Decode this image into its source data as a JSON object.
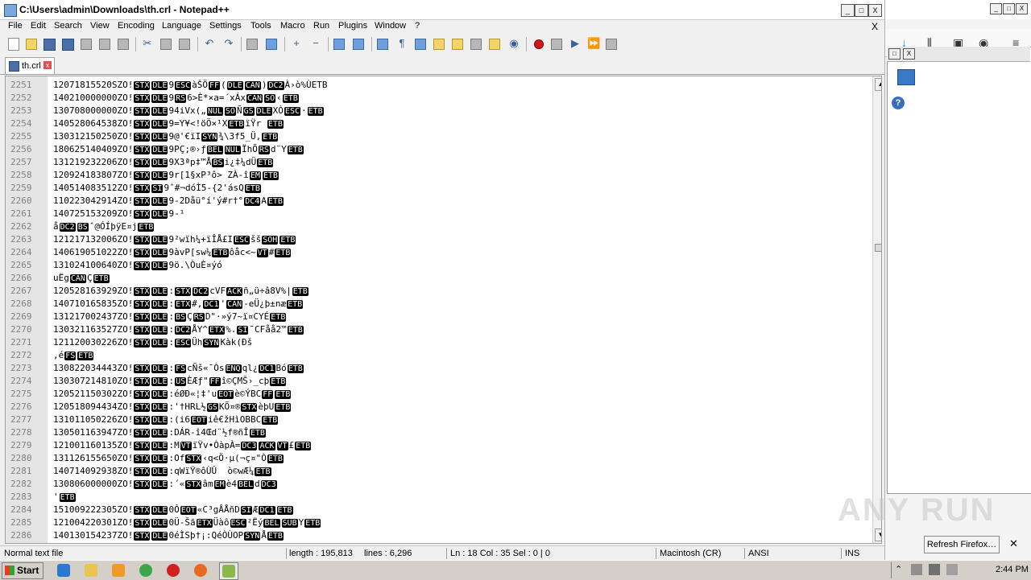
{
  "window": {
    "title": "C:\\Users\\admin\\Downloads\\th.crl - Notepad++",
    "controls": [
      "_",
      "□",
      "X"
    ]
  },
  "menu": [
    "File",
    "Edit",
    "Search",
    "View",
    "Encoding",
    "Language",
    "Settings",
    "Tools",
    "Macro",
    "Run",
    "Plugins",
    "Window",
    "?"
  ],
  "menu_close": "X",
  "tab": {
    "label": "th.crl",
    "close": "x"
  },
  "editor": {
    "lines": [
      {
        "n": "2251",
        "t": "12071815520SZO!⟦STX⟧⟦DLE⟧9⟦ESC⟧àŠÖ⟦FF⟧(⟦DLE⟧⟦CAN⟧)⟦DC2⟧À›ò%ÙETB"
      },
      {
        "n": "2252",
        "t": "140210000000ZO!⟦STX⟧⟦DLE⟧9⟦RS⟧6>È*×a=´xÁx⟦CAN⟧⟦SO⟧‹⟦ETB⟧"
      },
      {
        "n": "2253",
        "t": "130708000000ZO!⟦STX⟧⟦DLE⟧94iVx(„⟦NUL⟧⟦SO⟧Ñ⟦GS⟧⟦DLE⟧XÒ⟦ESC⟧·⟦ETB⟧"
      },
      {
        "n": "2254",
        "t": "14052806453 8ZO!⟦STX⟧⟦DLE⟧9=Y¥<!öÖ×¹X⟦ETB⟧ïŸr ⟦ETB⟧"
      },
      {
        "n": "2255",
        "t": "13031215025 0ZO!⟦STX⟧⟦DLE⟧9@'€ïI⟦SYN⟧¾\\3f5_Ü,⟦ETB⟧"
      },
      {
        "n": "2256",
        "t": "18062514040 9ZO!⟦STX⟧⟦DLE⟧9PÇ;®›ƒ⟦BEL⟧⟦NUL⟧ÏhÕ⟦RS⟧d¨Y⟦ETB⟧"
      },
      {
        "n": "2257",
        "t": "13121923220 6ZO!⟦STX⟧⟦DLE⟧9X3ªp‡™Å⟦BS⟧i¿‡¼dÜ⟦ETB⟧"
      },
      {
        "n": "2258",
        "t": "12092418380 7ZO!⟦STX⟧⟦DLE⟧9r[1§xP³ô> ZÀ-î⟦EM⟧⟦ETB⟧"
      },
      {
        "n": "2259",
        "t": "14051408351 2ZO!⟦STX⟧⟦SI⟧9ˆ#¬dóÌ5-{2'ásQ⟦ETB⟧"
      },
      {
        "n": "2260",
        "t": "11022304291 4ZO!⟦STX⟧⟦DLE⟧9-2Dåü°í'ý#r†°⟦DC4⟧A⟦ETB⟧"
      },
      {
        "n": "2261",
        "t": "14072515320 9ZO!⟦STX⟧⟦DLE⟧9-¹"
      },
      {
        "n": "2262",
        "t": "å⟦DC2⟧⟦BS⟧ˆ@ÓÍþÿE¤j⟦ETB⟧"
      },
      {
        "n": "2263",
        "t": "12121713200 6ZO!⟦STX⟧⟦DLE⟧9²wïh¼+ïÎÅ£I⟦ESC⟧šš⟦SOH⟧⟦ETB⟧"
      },
      {
        "n": "2264",
        "t": "14061905102 2ZO!⟦STX⟧⟦DLE⟧9àvP[sw¼⟦ETB⟧ôåc<~⟦VT⟧#⟦ETB⟧"
      },
      {
        "n": "2265",
        "t": "13102410064 0ZO!⟦STX⟧⟦DLE⟧9ö.\\ÒuÈ¤ýó"
      },
      {
        "n": "2266",
        "t": "uËg⟦CAN⟧Ç⟦ETB⟧"
      },
      {
        "n": "2267",
        "t": "12052816392 9ZO!⟦STX⟧⟦DLE⟧:⟦STX⟧⟦DC2⟧cVF⟦ACK⟧ñ„ü÷â8V%|⟦ETB⟧"
      },
      {
        "n": "2268",
        "t": "14071016583 5ZO!⟦STX⟧⟦DLE⟧:⟦ETX⟧#,⟦DC1⟧'⟦CAN⟧-eÜ¿þ±næ⟦ETB⟧"
      },
      {
        "n": "2269",
        "t": "13121700243 7ZO!⟦STX⟧⟦DLE⟧:⟦BS⟧Ç⟦RS⟧D\"·»ý7~ï¤CYÉ⟦ETB⟧"
      },
      {
        "n": "2270",
        "t": "13032116352 7ZO!⟦STX⟧⟦DLE⟧:⟦DC2⟧ÅY^⟦ETX⟧%.⟦SI⟧¯CFåå2™⟦ETB⟧"
      },
      {
        "n": "2271",
        "t": "12112003022 6ZO!⟦STX⟧⟦DLE⟧:⟦ESC⟧Üh⟦SYN⟧Kàk(Ðš"
      },
      {
        "n": "2272",
        "t": "‚é⟦FS⟧⟦ETB⟧"
      },
      {
        "n": "2273",
        "t": "13082203444 3ZO!⟦STX⟧⟦DLE⟧:⟦FS⟧cÑš«¯Òs⟦ENQ⟧ql¿⟦DC1⟧Bó⟦ETB⟧"
      },
      {
        "n": "2274",
        "t": "13030721481 0ZO!⟦STX⟧⟦DLE⟧:⟦US⟧ÈÆƒ\"⟦FF⟧î©ÇMŠ›_cþ⟦ETB⟧"
      },
      {
        "n": "2275",
        "t": "12052115030 2ZO!⟦STX⟧⟦DLE⟧:éØÐ«¦‡'u⟦EOT⟧è©ÝBC⟦FF⟧⟦ETB⟧"
      },
      {
        "n": "2276",
        "t": "12051809443 4ZO!⟦STX⟧⟦DLE⟧:'†HRL½⟦GS⟧KÕ¤®⟦STX⟧èþU⟦ETB⟧"
      },
      {
        "n": "2277",
        "t": "13101105022 6ZO!⟦STX⟧⟦DLE⟧:(i6⟦EOT⟧iê€žHìOBBC⟦ETB⟧"
      },
      {
        "n": "2278",
        "t": "13050116394 7ZO!⟦STX⟧⟦DLE⟧:DÁR-î4Œd¨½f®ñÎ⟦ETB⟧"
      },
      {
        "n": "2279",
        "t": "12100116013 5ZO!⟦STX⟧⟦DLE⟧:M⟦VT⟧ïŸv•ÒàpÀ=⟦DC3⟧⟦ACK⟧⟦VT⟧£⟦ETB⟧"
      },
      {
        "n": "2280",
        "t": "13112615565 0ZO!⟦STX⟧⟦DLE⟧:Of⟦STX⟧‹q<Ö·µ(¬ç¤\"Ò⟦ETB⟧"
      },
      {
        "n": "2281",
        "t": "14071409293 8ZO!⟦STX⟧⟦DLE⟧:qWïŸ®ôÙÛ  ò©wÆ¼⟦ETB⟧"
      },
      {
        "n": "2282",
        "t": "13080600000 0ZO!⟦STX⟧⟦DLE⟧:´«⟦STX⟧âm⟦EM⟧è4⟦BEL⟧d⟦DC3⟧"
      },
      {
        "n": "2283",
        "t": "'⟦ETB⟧"
      },
      {
        "n": "2284",
        "t": "15100922230 5ZO!⟦STX⟧⟦DLE⟧0Ô⟦EOT⟧«C³gÂÅñD⟦SI⟧Æ⟦DC1⟧⟦ETB⟧"
      },
      {
        "n": "2285",
        "t": "12100422030 1ZO!⟦STX⟧⟦DLE⟧0Ü-Šã⟦ETX⟧Üàô⟦ESC⟧²Ëý⟦BEL⟧⟦SUB⟧Y⟦ETB⟧"
      },
      {
        "n": "2286",
        "t": "14013015423 7ZO!⟦STX⟧⟦DLE⟧0éÌSþ†¡:QéÒÙOP⟦SYN⟧Å⟦ETB⟧"
      }
    ]
  },
  "status": {
    "type": "Normal text file",
    "length": "length : 195,813",
    "lines": "lines : 6,296",
    "position": "Ln : 18   Col : 35   Sel : 0 | 0",
    "eol": "Macintosh (CR)",
    "encoding": "ANSI",
    "mode": "INS"
  },
  "firefox": {
    "refresh_label": "Refresh Firefox…",
    "help_label": "?",
    "controls": [
      "_",
      "□",
      "X"
    ]
  },
  "taskbar": {
    "start_label": "Start",
    "clock": "2:44 PM"
  },
  "watermark": "ANY RUN"
}
